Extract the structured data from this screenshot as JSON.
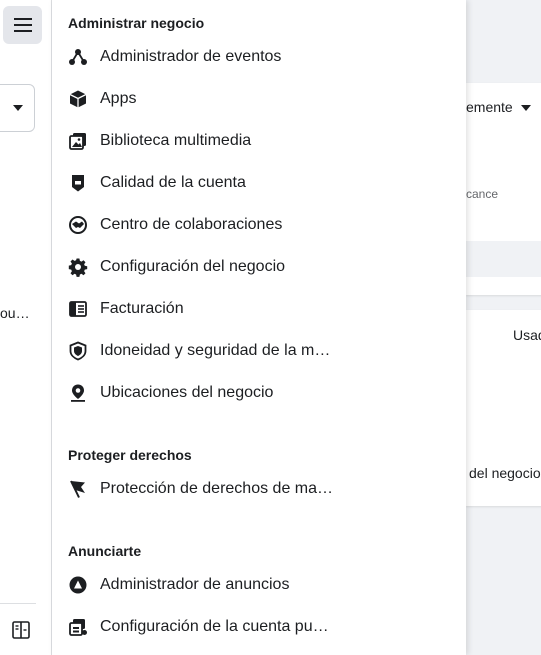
{
  "rail": {
    "truncated_text": "ou…"
  },
  "background": {
    "selector_text": "emente",
    "small_text": "cance",
    "right_label": "Usad",
    "business_label": "del negocio"
  },
  "menu": {
    "sections": [
      {
        "title": "Administrar negocio",
        "items": [
          {
            "label": "Administrador de eventos",
            "icon": "event-manager-icon"
          },
          {
            "label": "Apps",
            "icon": "cube-icon"
          },
          {
            "label": "Biblioteca multimedia",
            "icon": "media-library-icon"
          },
          {
            "label": "Calidad de la cuenta",
            "icon": "account-quality-icon"
          },
          {
            "label": "Centro de colaboraciones",
            "icon": "handshake-icon"
          },
          {
            "label": "Configuración del negocio",
            "icon": "gear-icon"
          },
          {
            "label": "Facturación",
            "icon": "billing-icon"
          },
          {
            "label": "Idoneidad y seguridad de la m…",
            "icon": "shield-icon"
          },
          {
            "label": "Ubicaciones del negocio",
            "icon": "location-pin-icon"
          }
        ]
      },
      {
        "title": "Proteger derechos",
        "items": [
          {
            "label": "Protección de derechos de ma…",
            "icon": "flag-icon"
          }
        ]
      },
      {
        "title": "Anunciarte",
        "items": [
          {
            "label": "Administrador de anuncios",
            "icon": "ads-manager-icon"
          },
          {
            "label": "Configuración de la cuenta pu…",
            "icon": "ad-account-settings-icon"
          }
        ]
      }
    ]
  }
}
